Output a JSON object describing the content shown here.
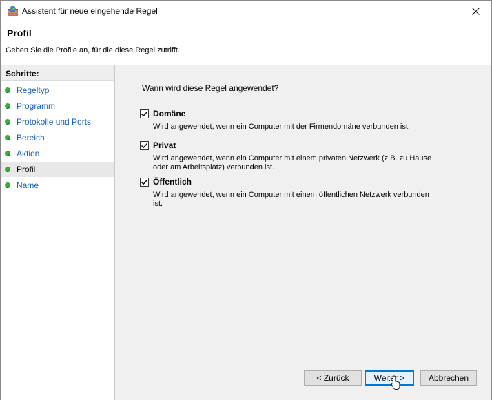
{
  "window": {
    "title": "Assistent für neue eingehende Regel",
    "close_symbol": "✕"
  },
  "header": {
    "title": "Profil",
    "description": "Geben Sie die Profile an, für die diese Regel zutrifft."
  },
  "steps": {
    "heading": "Schritte:",
    "items": [
      {
        "label": "Regeltyp"
      },
      {
        "label": "Programm"
      },
      {
        "label": "Protokolle und Ports"
      },
      {
        "label": "Bereich"
      },
      {
        "label": "Aktion"
      },
      {
        "label": "Profil",
        "current": true
      },
      {
        "label": "Name"
      }
    ]
  },
  "content": {
    "question": "Wann wird diese Regel angewendet?",
    "options": [
      {
        "title": "Domäne",
        "checked": true,
        "description": "Wird angewendet, wenn ein Computer mit der Firmendomäne verbunden ist."
      },
      {
        "title": "Privat",
        "checked": true,
        "description": "Wird angewendet, wenn ein Computer mit einem privaten Netzwerk (z.B. zu Hause oder am Arbeitsplatz) verbunden ist."
      },
      {
        "title": "Öffentlich",
        "checked": true,
        "description": "Wird angewendet, wenn ein Computer mit einem öffentlichen Netzwerk verbunden ist."
      }
    ]
  },
  "buttons": {
    "back": "< Zurück",
    "next": "Weiter >",
    "cancel": "Abbrechen"
  }
}
